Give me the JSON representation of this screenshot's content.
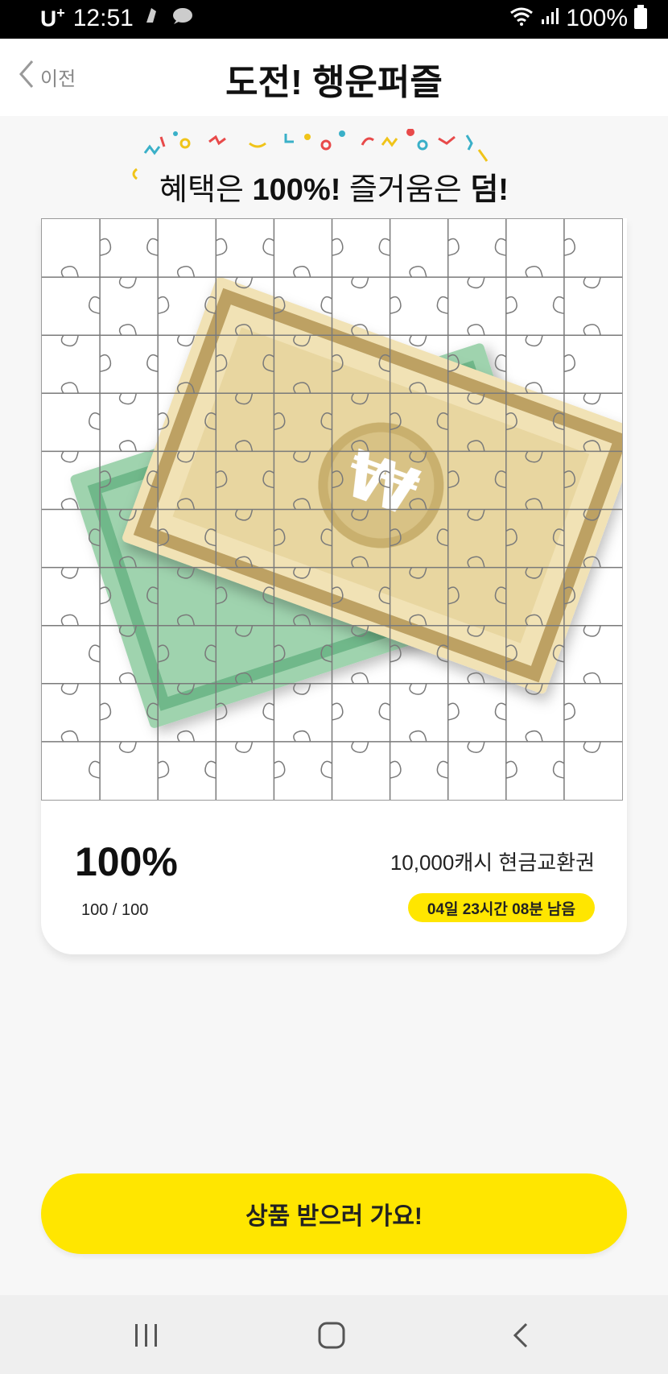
{
  "status_bar": {
    "carrier": "U",
    "carrier_sup": "+",
    "time": "12:51",
    "battery": "100%"
  },
  "header": {
    "back_label": "이전",
    "title": "도전! 행운퍼즐"
  },
  "banner": {
    "part1": "혜택은 ",
    "part2": "100%!",
    "part3": " 즐거움은 ",
    "part4": "덤!"
  },
  "puzzle": {
    "rows": 10,
    "cols": 10,
    "image": "money-bills-icon"
  },
  "progress": {
    "percent": "100%",
    "count": "100 / 100",
    "value": 1.0
  },
  "prize": {
    "name": "10,000캐시 현금교환권",
    "time_left": "04일 23시간 08분 남음"
  },
  "cta": {
    "label": "상품 받으러 가요!"
  },
  "colors": {
    "accent": "#ffe600",
    "bill_gold": "#e8d6a0",
    "bill_green": "#9fd3ae"
  }
}
